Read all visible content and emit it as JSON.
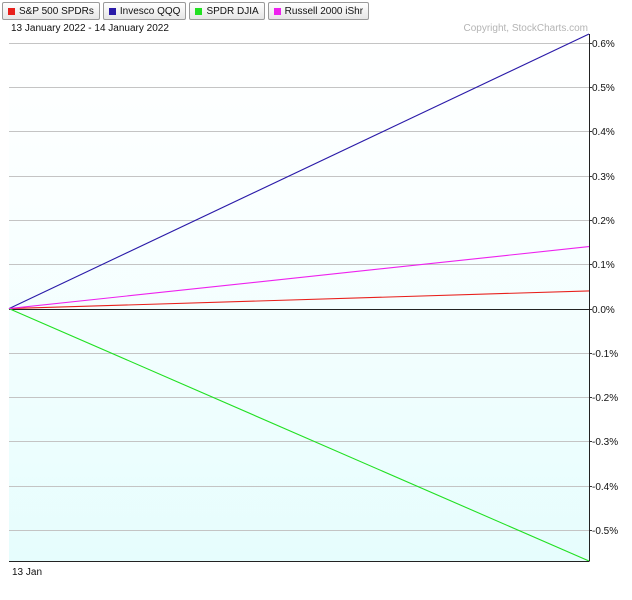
{
  "header": {
    "date_range": "13 January 2022 - 14 January 2022",
    "copyright": "Copyright, StockCharts.com"
  },
  "legend": [
    {
      "name": "S&P 500 SPDRs",
      "color": "#e8201c"
    },
    {
      "name": "Invesco QQQ",
      "color": "#2a1aa8"
    },
    {
      "name": "SPDR DJIA",
      "color": "#22e022"
    },
    {
      "name": "Russell 2000 iShr",
      "color": "#ee22ee"
    }
  ],
  "chart_data": {
    "type": "line",
    "title": "",
    "xlabel": "",
    "ylabel": "",
    "x": [
      "13 Jan",
      "14 Jan"
    ],
    "x_tick_labels": [
      "13 Jan"
    ],
    "ylim": [
      -0.57,
      0.62
    ],
    "yticks": [
      0.6,
      0.5,
      0.4,
      0.3,
      0.2,
      0.1,
      0.0,
      -0.1,
      -0.2,
      -0.3,
      -0.4,
      -0.5
    ],
    "ytick_labels": [
      "0.6%",
      "0.5%",
      "0.4%",
      "0.3%",
      "0.2%",
      "0.1%",
      "0.0%",
      "-0.1%",
      "-0.2%",
      "-0.3%",
      "-0.4%",
      "-0.5%"
    ],
    "grid": true,
    "legend_position": "top-left",
    "background_color": "#eefefe",
    "series": [
      {
        "name": "S&P 500 SPDRs",
        "color": "#e8201c",
        "values": [
          0.0,
          0.04
        ]
      },
      {
        "name": "Invesco QQQ",
        "color": "#2a1aa8",
        "values": [
          0.0,
          0.62
        ]
      },
      {
        "name": "SPDR DJIA",
        "color": "#22e022",
        "values": [
          0.0,
          -0.57
        ]
      },
      {
        "name": "Russell 2000 iShr",
        "color": "#ee22ee",
        "values": [
          0.0,
          0.14
        ]
      }
    ]
  }
}
